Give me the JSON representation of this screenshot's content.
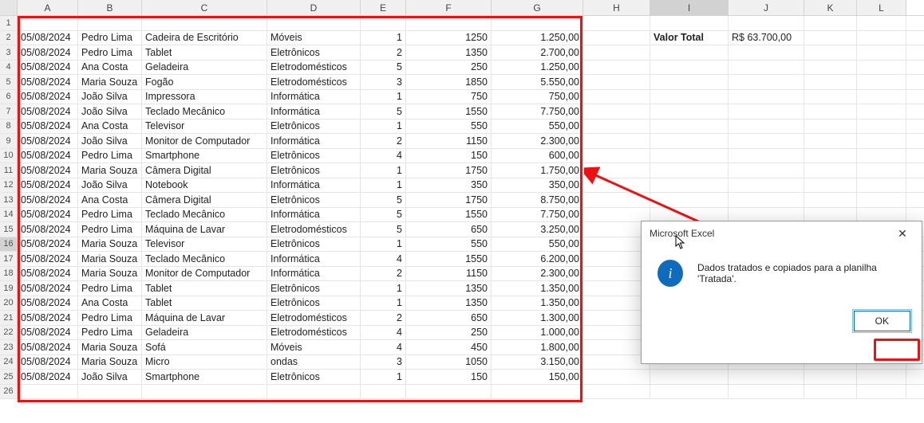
{
  "columns": [
    "A",
    "B",
    "C",
    "D",
    "E",
    "F",
    "G",
    "H",
    "I",
    "J",
    "K",
    "L"
  ],
  "col_widths": [
    "cA",
    "cB",
    "cC",
    "cD",
    "cE",
    "cF",
    "cG",
    "cH",
    "cI",
    "cJ",
    "cK",
    "cL"
  ],
  "active_col": "I",
  "selected_row": 16,
  "summary": {
    "label": "Valor Total",
    "currency": "R$",
    "value": "63.700,00"
  },
  "rows": [
    {
      "n": 1,
      "blank": true
    },
    {
      "n": 2,
      "d": "05/08/2024",
      "p": "Pedro Lima",
      "prod": "Cadeira de Escritório",
      "cat": "Móveis",
      "q": "1",
      "u": "1250",
      "t": "1.250,00"
    },
    {
      "n": 3,
      "d": "05/08/2024",
      "p": "Pedro Lima",
      "prod": "Tablet",
      "cat": "Eletrônicos",
      "q": "2",
      "u": "1350",
      "t": "2.700,00"
    },
    {
      "n": 4,
      "d": "05/08/2024",
      "p": "Ana Costa",
      "prod": "Geladeira",
      "cat": "Eletrodomésticos",
      "q": "5",
      "u": "250",
      "t": "1.250,00"
    },
    {
      "n": 5,
      "d": "05/08/2024",
      "p": "Maria Souza",
      "prod": "Fogão",
      "cat": "Eletrodomésticos",
      "q": "3",
      "u": "1850",
      "t": "5.550,00"
    },
    {
      "n": 6,
      "d": "05/08/2024",
      "p": "João Silva",
      "prod": "Impressora",
      "cat": "Informática",
      "q": "1",
      "u": "750",
      "t": "750,00"
    },
    {
      "n": 7,
      "d": "05/08/2024",
      "p": "João Silva",
      "prod": "Teclado Mecânico",
      "cat": "Informática",
      "q": "5",
      "u": "1550",
      "t": "7.750,00"
    },
    {
      "n": 8,
      "d": "05/08/2024",
      "p": "Ana Costa",
      "prod": "Televisor",
      "cat": "Eletrônicos",
      "q": "1",
      "u": "550",
      "t": "550,00"
    },
    {
      "n": 9,
      "d": "05/08/2024",
      "p": "João Silva",
      "prod": "Monitor de Computador",
      "cat": "Informática",
      "q": "2",
      "u": "1150",
      "t": "2.300,00"
    },
    {
      "n": 10,
      "d": "05/08/2024",
      "p": "Pedro Lima",
      "prod": "Smartphone",
      "cat": "Eletrônicos",
      "q": "4",
      "u": "150",
      "t": "600,00"
    },
    {
      "n": 11,
      "d": "05/08/2024",
      "p": "Maria Souza",
      "prod": "Câmera Digital",
      "cat": "Eletrônicos",
      "q": "1",
      "u": "1750",
      "t": "1.750,00"
    },
    {
      "n": 12,
      "d": "05/08/2024",
      "p": "João Silva",
      "prod": "Notebook",
      "cat": "Informática",
      "q": "1",
      "u": "350",
      "t": "350,00"
    },
    {
      "n": 13,
      "d": "05/08/2024",
      "p": "Ana Costa",
      "prod": "Câmera Digital",
      "cat": "Eletrônicos",
      "q": "5",
      "u": "1750",
      "t": "8.750,00"
    },
    {
      "n": 14,
      "d": "05/08/2024",
      "p": "Pedro Lima",
      "prod": "Teclado Mecânico",
      "cat": "Informática",
      "q": "5",
      "u": "1550",
      "t": "7.750,00"
    },
    {
      "n": 15,
      "d": "05/08/2024",
      "p": "Pedro Lima",
      "prod": "Máquina de Lavar",
      "cat": "Eletrodomésticos",
      "q": "5",
      "u": "650",
      "t": "3.250,00"
    },
    {
      "n": 16,
      "d": "05/08/2024",
      "p": "Maria Souza",
      "prod": "Televisor",
      "cat": "Eletrônicos",
      "q": "1",
      "u": "550",
      "t": "550,00"
    },
    {
      "n": 17,
      "d": "05/08/2024",
      "p": "Maria Souza",
      "prod": "Teclado Mecânico",
      "cat": "Informática",
      "q": "4",
      "u": "1550",
      "t": "6.200,00"
    },
    {
      "n": 18,
      "d": "05/08/2024",
      "p": "Maria Souza",
      "prod": "Monitor de Computador",
      "cat": "Informática",
      "q": "2",
      "u": "1150",
      "t": "2.300,00"
    },
    {
      "n": 19,
      "d": "05/08/2024",
      "p": "Pedro Lima",
      "prod": "Tablet",
      "cat": "Eletrônicos",
      "q": "1",
      "u": "1350",
      "t": "1.350,00"
    },
    {
      "n": 20,
      "d": "05/08/2024",
      "p": "Ana Costa",
      "prod": "Tablet",
      "cat": "Eletrônicos",
      "q": "1",
      "u": "1350",
      "t": "1.350,00"
    },
    {
      "n": 21,
      "d": "05/08/2024",
      "p": "Pedro Lima",
      "prod": "Máquina de Lavar",
      "cat": "Eletrodomésticos",
      "q": "2",
      "u": "650",
      "t": "1.300,00"
    },
    {
      "n": 22,
      "d": "05/08/2024",
      "p": "Pedro Lima",
      "prod": "Geladeira",
      "cat": "Eletrodomésticos",
      "q": "4",
      "u": "250",
      "t": "1.000,00"
    },
    {
      "n": 23,
      "d": "05/08/2024",
      "p": "Maria Souza",
      "prod": "Sofá",
      "cat": "Móveis",
      "q": "4",
      "u": "450",
      "t": "1.800,00"
    },
    {
      "n": 24,
      "d": "05/08/2024",
      "p": "Maria Souza",
      "prod": "Micro",
      "cat": "ondas",
      "q": "3",
      "u": "1050",
      "t": "3.150,00"
    },
    {
      "n": 25,
      "d": "05/08/2024",
      "p": "João Silva",
      "prod": "Smartphone",
      "cat": "Eletrônicos",
      "q": "1",
      "u": "150",
      "t": "150,00"
    },
    {
      "n": 26,
      "blank": true
    }
  ],
  "dialog": {
    "title": "Microsoft Excel",
    "message": "Dados tratados e copiados para a planilha 'Tratada'.",
    "ok": "OK",
    "info_glyph": "i",
    "close": "✕"
  }
}
